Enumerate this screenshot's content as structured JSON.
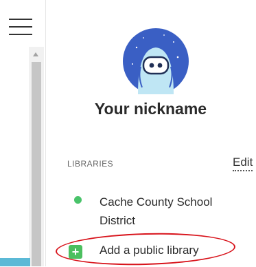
{
  "profile": {
    "nickname": "Your nickname",
    "avatar_icon": "robot-avatar-icon"
  },
  "libraries": {
    "section_label": "LIBRARIES",
    "edit_label": "Edit",
    "items": [
      {
        "name": "Cache County School District",
        "status_color": "#49c36a"
      }
    ],
    "add_label": "Add a public library"
  },
  "nav": {
    "menu_icon": "hamburger-menu-icon"
  }
}
